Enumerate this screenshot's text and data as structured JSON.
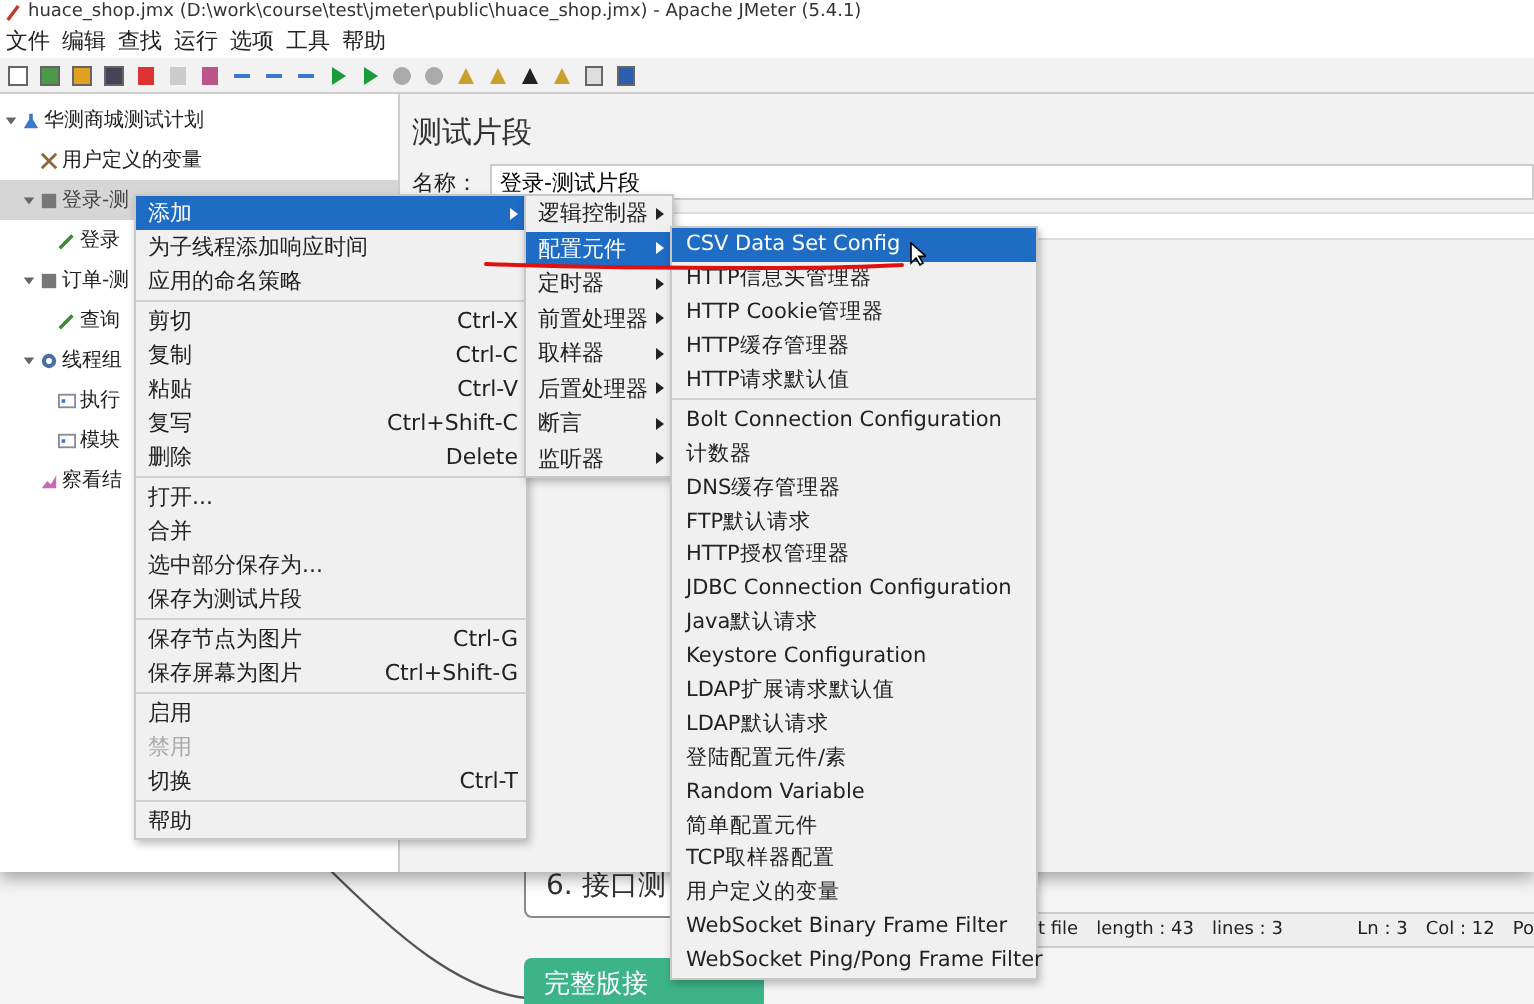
{
  "window": {
    "title": "huace_shop.jmx (D:\\work\\course\\test\\jmeter\\public\\huace_shop.jmx) - Apache JMeter (5.4.1)"
  },
  "menu_bar": [
    "文件",
    "编辑",
    "查找",
    "运行",
    "选项",
    "工具",
    "帮助"
  ],
  "tree": [
    {
      "label": "华测商城测试计划",
      "kind": "plan",
      "expanded": true,
      "selected": false,
      "children": [
        {
          "label": "用户定义的变量",
          "kind": "variables",
          "selected": false
        },
        {
          "label": "登录-测",
          "kind": "fragment",
          "expanded": true,
          "selected": true,
          "children": [
            {
              "label": "登录",
              "kind": "sampler",
              "selected": false
            }
          ]
        },
        {
          "label": "订单-测",
          "kind": "fragment",
          "expanded": true,
          "selected": false,
          "children": [
            {
              "label": "查询",
              "kind": "sampler",
              "selected": false
            }
          ]
        },
        {
          "label": "线程组",
          "kind": "thread-group",
          "expanded": true,
          "selected": false,
          "children": [
            {
              "label": "执行",
              "kind": "controller",
              "selected": false
            },
            {
              "label": "模块",
              "kind": "controller",
              "selected": false
            }
          ]
        },
        {
          "label": "察看结",
          "kind": "listener",
          "selected": false
        }
      ]
    }
  ],
  "editor": {
    "heading": "测试片段",
    "name_label": "名称：",
    "name_value": "登录-测试片段"
  },
  "context_menu": {
    "groups": [
      [
        {
          "label": "添加",
          "submenu": true,
          "selected": true,
          "disabled": false
        },
        {
          "label": "为子线程添加响应时间",
          "submenu": false,
          "selected": false,
          "disabled": false
        },
        {
          "label": "应用的命名策略",
          "submenu": false,
          "selected": false,
          "disabled": false
        }
      ],
      [
        {
          "label": "剪切",
          "shortcut": "Ctrl-X",
          "submenu": false,
          "selected": false,
          "disabled": false
        },
        {
          "label": "复制",
          "shortcut": "Ctrl-C",
          "submenu": false,
          "selected": false,
          "disabled": false
        },
        {
          "label": "粘贴",
          "shortcut": "Ctrl-V",
          "submenu": false,
          "selected": false,
          "disabled": false
        },
        {
          "label": "复写",
          "shortcut": "Ctrl+Shift-C",
          "submenu": false,
          "selected": false,
          "disabled": false
        },
        {
          "label": "删除",
          "shortcut": "Delete",
          "submenu": false,
          "selected": false,
          "disabled": false
        }
      ],
      [
        {
          "label": "打开...",
          "submenu": false,
          "selected": false,
          "disabled": false
        },
        {
          "label": "合并",
          "submenu": false,
          "selected": false,
          "disabled": false
        },
        {
          "label": "选中部分保存为...",
          "submenu": false,
          "selected": false,
          "disabled": false
        },
        {
          "label": "保存为测试片段",
          "submenu": false,
          "selected": false,
          "disabled": false
        }
      ],
      [
        {
          "label": "保存节点为图片",
          "shortcut": "Ctrl-G",
          "submenu": false,
          "selected": false,
          "disabled": false
        },
        {
          "label": "保存屏幕为图片",
          "shortcut": "Ctrl+Shift-G",
          "submenu": false,
          "selected": false,
          "disabled": false
        }
      ],
      [
        {
          "label": "启用",
          "submenu": false,
          "selected": false,
          "disabled": false
        },
        {
          "label": "禁用",
          "submenu": false,
          "selected": false,
          "disabled": true
        },
        {
          "label": "切换",
          "shortcut": "Ctrl-T",
          "submenu": false,
          "selected": false,
          "disabled": false
        }
      ],
      [
        {
          "label": "帮助",
          "submenu": false,
          "selected": false,
          "disabled": false
        }
      ]
    ]
  },
  "add_submenu": {
    "items": [
      {
        "label": "逻辑控制器",
        "selected": false
      },
      {
        "label": "配置元件",
        "selected": true
      },
      {
        "label": "定时器",
        "selected": false
      },
      {
        "label": "前置处理器",
        "selected": false
      },
      {
        "label": "取样器",
        "selected": false
      },
      {
        "label": "后置处理器",
        "selected": false
      },
      {
        "label": "断言",
        "selected": false
      },
      {
        "label": "监听器",
        "selected": false
      }
    ]
  },
  "config_submenu": {
    "groups": [
      [
        {
          "label": "CSV Data Set Config",
          "selected": true
        },
        {
          "label": "HTTP信息头管理器",
          "selected": false
        },
        {
          "label": "HTTP Cookie管理器",
          "selected": false
        },
        {
          "label": "HTTP缓存管理器",
          "selected": false
        },
        {
          "label": "HTTP请求默认值",
          "selected": false
        }
      ],
      [
        {
          "label": "Bolt Connection Configuration",
          "selected": false
        },
        {
          "label": "计数器",
          "selected": false
        },
        {
          "label": "DNS缓存管理器",
          "selected": false
        },
        {
          "label": "FTP默认请求",
          "selected": false
        },
        {
          "label": "HTTP授权管理器",
          "selected": false
        },
        {
          "label": "JDBC Connection Configuration",
          "selected": false
        },
        {
          "label": "Java默认请求",
          "selected": false
        },
        {
          "label": "Keystore Configuration",
          "selected": false
        },
        {
          "label": "LDAP扩展请求默认值",
          "selected": false
        },
        {
          "label": "LDAP默认请求",
          "selected": false
        },
        {
          "label": "登陆配置元件/素",
          "selected": false
        },
        {
          "label": "Random Variable",
          "selected": false
        },
        {
          "label": "简单配置元件",
          "selected": false
        },
        {
          "label": "TCP取样器配置",
          "selected": false
        },
        {
          "label": "用户定义的变量",
          "selected": false
        },
        {
          "label": "WebSocket Binary Frame Filter",
          "selected": false
        },
        {
          "label": "WebSocket Ping/Pong Frame Filter",
          "selected": false
        }
      ]
    ]
  },
  "background_app": {
    "nodes": [
      {
        "label": "6. 接口测",
        "kind": "outline"
      },
      {
        "label": "完整版接",
        "kind": "filled"
      }
    ],
    "status_bar": [
      "t file",
      "length : 43",
      "lines : 3",
      "Ln : 3",
      "Col : 12",
      "Po"
    ]
  }
}
